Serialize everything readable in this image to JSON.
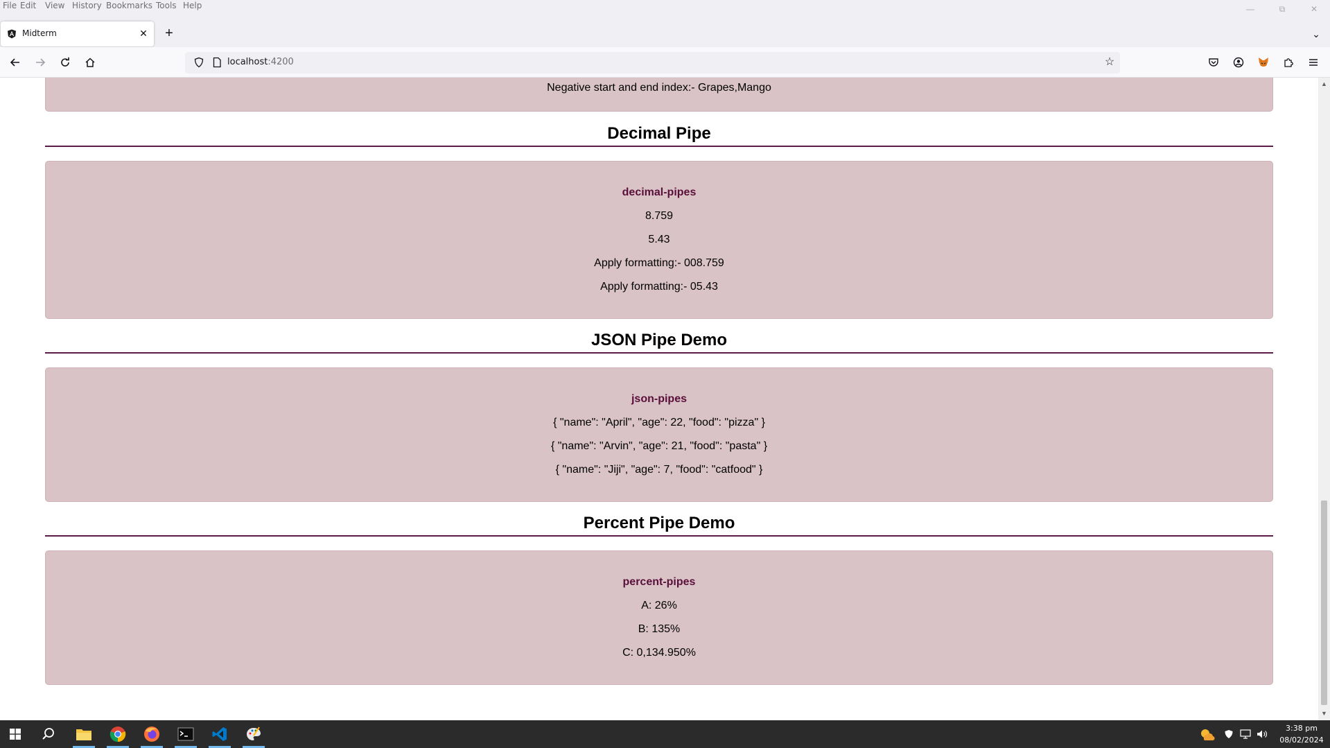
{
  "menu": {
    "items": [
      "File",
      "Edit",
      "View",
      "History",
      "Bookmarks",
      "Tools",
      "Help"
    ]
  },
  "tab": {
    "title": "Midterm"
  },
  "url": {
    "host": "localhost",
    "port": ":4200"
  },
  "page": {
    "partial_line": "Negative start and end index:- Grapes,Mango",
    "sections": [
      {
        "heading": "Decimal Pipe",
        "panel_title": "decimal-pipes",
        "lines": [
          "8.759",
          "5.43",
          "Apply formatting:- 008.759",
          "Apply formatting:- 05.43"
        ]
      },
      {
        "heading": "JSON Pipe Demo",
        "panel_title": "json-pipes",
        "lines": [
          "{ \"name\": \"April\", \"age\": 22, \"food\": \"pizza\" }",
          "{ \"name\": \"Arvin\", \"age\": 21, \"food\": \"pasta\" }",
          "{ \"name\": \"Jiji\", \"age\": 7, \"food\": \"catfood\" }"
        ]
      },
      {
        "heading": "Percent Pipe Demo",
        "panel_title": "percent-pipes",
        "lines": [
          "A: 26%",
          "B: 135%",
          "C: 0,134.950%"
        ]
      }
    ]
  },
  "taskbar": {
    "time": "3:38 pm",
    "date": "08/02/2024"
  },
  "colors": {
    "panel_bg": "#d9c3c7",
    "accent_text": "#5a0f3a",
    "rule": "#5a1a4a"
  }
}
